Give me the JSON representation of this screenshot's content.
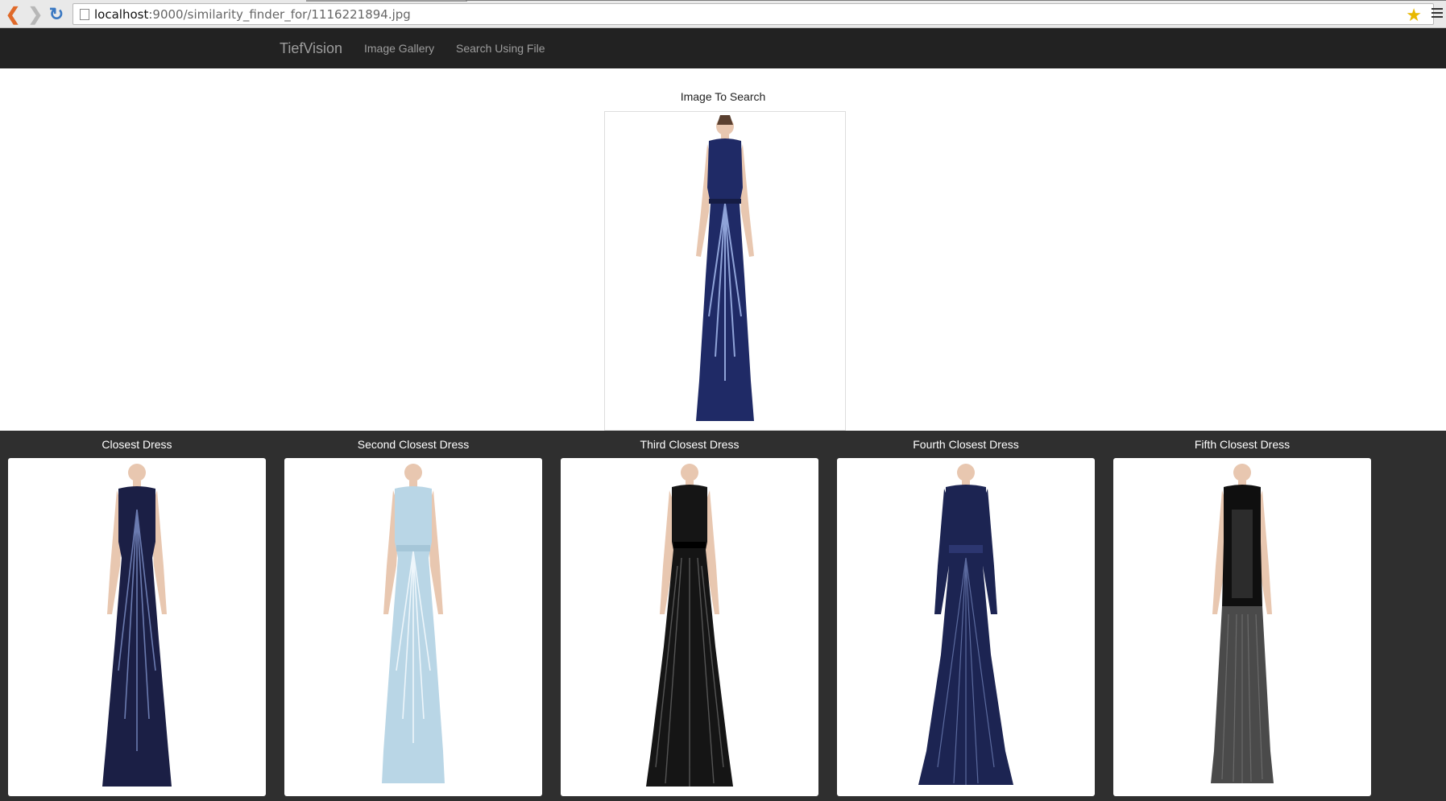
{
  "browser": {
    "url_host": "localhost",
    "url_path": ":9000/similarity_finder_for/1116221894.jpg"
  },
  "navbar": {
    "brand": "TiefVision",
    "links": [
      {
        "label": "Image Gallery"
      },
      {
        "label": "Search Using File"
      }
    ]
  },
  "query": {
    "title": "Image To Search",
    "dress_color": "#1f2a66",
    "accent": "#8fa3d8"
  },
  "results": [
    {
      "title": "Closest Dress",
      "dress_color": "#1b1f45",
      "accent": "#6b7bb0"
    },
    {
      "title": "Second Closest Dress",
      "dress_color": "#b9d6e6",
      "accent": "#eef6fb"
    },
    {
      "title": "Third Closest Dress",
      "dress_color": "#151515",
      "accent": "#555555"
    },
    {
      "title": "Fourth Closest Dress",
      "dress_color": "#1c2452",
      "accent": "#5b6a9e"
    },
    {
      "title": "Fifth Closest Dress",
      "dress_color": "#0f0f0f",
      "accent": "#6a6a6a"
    }
  ],
  "colors": {
    "navbar_bg": "#222222",
    "navbar_text": "#9d9d9d",
    "results_bg": "#2f2f2f"
  }
}
